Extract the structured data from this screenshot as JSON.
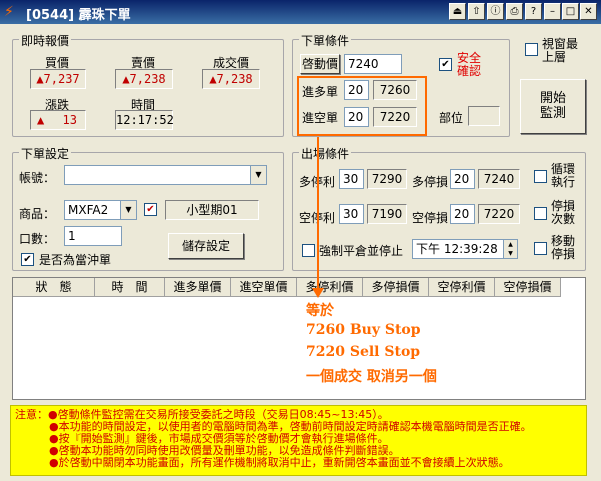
{
  "window": {
    "title": "[0544] 霹珠下單",
    "controls": [
      "⏏",
      "⇧",
      "ⓘ",
      "⎙",
      "?",
      "–",
      "□",
      "✕"
    ]
  },
  "quote": {
    "group_title": "即時報價",
    "buy_label": "買價",
    "buy_value": "▲7,237",
    "sell_label": "賣價",
    "sell_value": "▲7,238",
    "trade_label": "成交價",
    "trade_value": "▲7,238",
    "change_label": "漲跌",
    "change_arrow": "▲",
    "change_value": "13",
    "time_label": "時間",
    "time_value": "12:17:52"
  },
  "order_condition": {
    "group_title": "下單條件",
    "trigger_button": "啓動價",
    "trigger_value": "7240",
    "safety_confirm": "安全確認",
    "safety_checked": true,
    "long_label": "進多單",
    "long_offset": "20",
    "long_price": "7260",
    "short_label": "進空單",
    "short_offset": "20",
    "short_price": "7220",
    "position_label": "部位",
    "position_value": "",
    "start_button": "開始監測"
  },
  "window_option": {
    "topmost_label": "視窗最上層"
  },
  "order_setup": {
    "group_title": "下單設定",
    "account_label": "帳號：",
    "account_value": "",
    "product_label": "商品：",
    "product_value": "MXFA2",
    "product_checked": true,
    "product_name": "小型期01",
    "qty_label": "口數：",
    "qty_value": "1",
    "close_label": "是否為當沖單",
    "close_checked": true,
    "save_button": "儲存設定"
  },
  "exit_condition": {
    "group_title": "出場條件",
    "long_tp_label": "多停利",
    "long_tp_offset": "30",
    "long_tp_price": "7290",
    "long_sl_label": "多停損",
    "long_sl_offset": "20",
    "long_sl_price": "7240",
    "short_tp_label": "空停利",
    "short_tp_offset": "30",
    "short_tp_price": "7190",
    "short_sl_label": "空停損",
    "short_sl_offset": "20",
    "short_sl_price": "7220",
    "force_label": "強制平倉並停止",
    "force_checked": false,
    "force_time": "下午 12:39:28",
    "loop_label": "循環執行",
    "stopcount_label": "停損次數",
    "move_label": "移動停損"
  },
  "table": {
    "columns": [
      "狀　態",
      "時　間",
      "進多單價",
      "進空單價",
      "多停利價",
      "多停損價",
      "空停利價",
      "空停損價"
    ]
  },
  "annotation": [
    "等於",
    "7260 Buy Stop",
    "7220 Sell Stop",
    "一個成交 取消另一個"
  ],
  "notice": [
    "注意：●啓動條件監控需在交易所接受委託之時段（交易日08:45~13:45）。",
    "●本功能的時間設定，以使用者的電腦時間為準，啓動前時間設定時請確認本機電腦時間是否正確。",
    "●按『開始監測』鍵後，市場成交價須等於啓動價才會執行進場條件。",
    "●啓動本功能時勿同時使用改價量及刪單功能，以免造成條件判斷錯誤。",
    "●於啓動中關閉本功能畫面，所有運作機制將取消中止，重新開啓本畫面並不會接續上次狀態。"
  ],
  "colors": {
    "accent": "#ff6a00",
    "price_red": "#c00000",
    "notice_bg": "#ffff00"
  }
}
